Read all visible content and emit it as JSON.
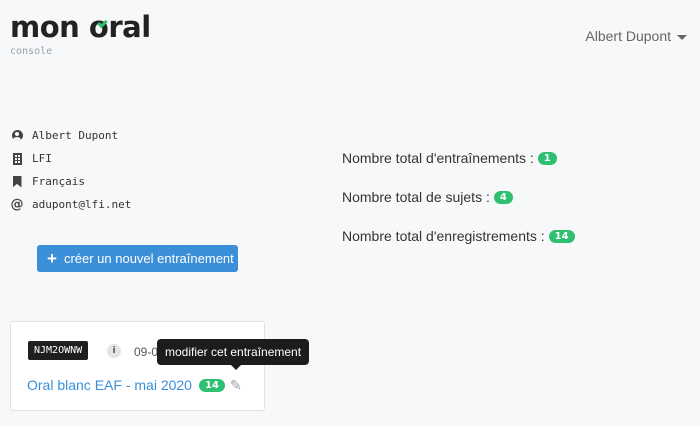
{
  "header": {
    "logo_text_1": "mon ",
    "logo_text_o": "o",
    "logo_text_2": "ral",
    "logo_subtitle": "console",
    "user_name": "Albert Dupont"
  },
  "profile": {
    "name": "Albert Dupont",
    "organization": "LFI",
    "language": "Français",
    "email": "adupont@lfi.net",
    "icons": [
      "user-circle-icon",
      "building-icon",
      "bookmark-icon",
      "at-icon"
    ]
  },
  "create_button_label": "créer un nouvel entraînement",
  "stats": [
    {
      "label": "Nombre total d'entraînements :",
      "count": "1"
    },
    {
      "label": "Nombre total de sujets :",
      "count": "4"
    },
    {
      "label": "Nombre total d'enregistrements :",
      "count": "14"
    }
  ],
  "training_card": {
    "code": "NJM2OWNW",
    "info_glyph": "i",
    "date": "09-0",
    "title": "Oral blanc EAF - mai 2020",
    "recordings_count": "14"
  },
  "tooltip": "modifier cet entraînement",
  "colors": {
    "accent_blue": "#3b8fd9",
    "badge_green": "#2fbf71",
    "dark_tag": "#1f1f1f"
  }
}
